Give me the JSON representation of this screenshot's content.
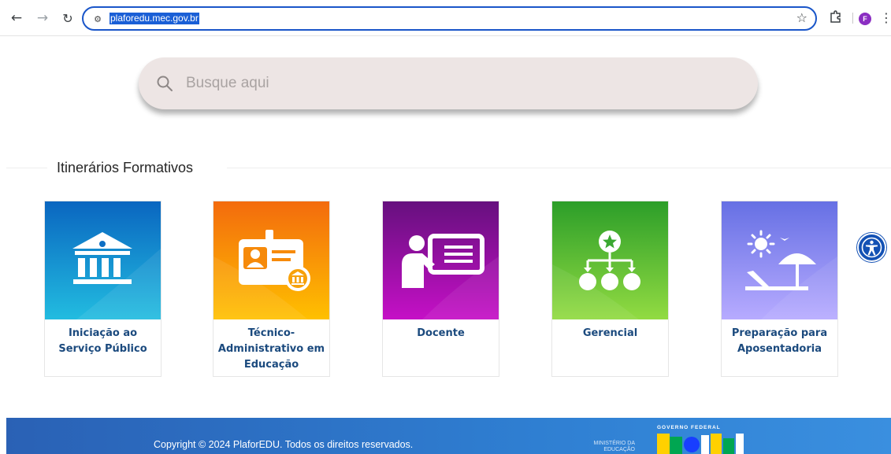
{
  "browser": {
    "url": "plaforedu.mec.gov.br",
    "profile_initial": "F"
  },
  "search": {
    "placeholder": "Busque aqui",
    "value": ""
  },
  "section": {
    "title": "Itinerários Formativos"
  },
  "cards": [
    {
      "label": "Iniciação ao Serviço Público",
      "icon": "government-building-icon",
      "colors": [
        "#0a6cc4",
        "#1fb8de"
      ]
    },
    {
      "label": "Técnico-Administrativo em Educação",
      "icon": "id-badge-icon",
      "colors": [
        "#f36f0b",
        "#ffc300"
      ]
    },
    {
      "label": "Docente",
      "icon": "teacher-board-icon",
      "colors": [
        "#6a0d83",
        "#c20ec4"
      ]
    },
    {
      "label": "Gerencial",
      "icon": "hierarchy-icon",
      "colors": [
        "#2ea12a",
        "#8fd93f"
      ]
    },
    {
      "label": "Preparação para Aposentadoria",
      "icon": "beach-umbrella-icon",
      "colors": [
        "#6a73e6",
        "#b3a9ff"
      ]
    }
  ],
  "footer": {
    "copyright": "Copyright © 2024 PlaforEDU. Todos os direitos reservados.",
    "ministry": "MINISTÉRIO DA EDUCAÇÃO",
    "gov_label": "GOVERNO FEDERAL",
    "brasil_logo_text": "BRASIL"
  },
  "colors": {
    "accent": "#1a56c9",
    "card_label": "#1b4a7e",
    "footer": "#2f7fd2"
  }
}
